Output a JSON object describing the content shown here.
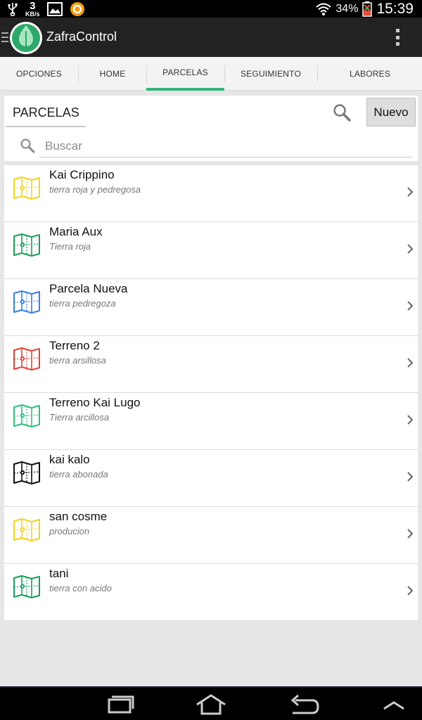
{
  "status_bar": {
    "net_speed_value": "3",
    "net_speed_unit": "KB/s",
    "battery": "34%",
    "time": "15:39",
    "icons": [
      "usb-icon",
      "image-icon",
      "app-notify-icon",
      "wifi-icon",
      "battery-icon"
    ]
  },
  "action_bar": {
    "title": "ZafraControl",
    "icons": [
      "drawer-menu-icon",
      "leaf-logo-icon",
      "overflow-menu-icon"
    ]
  },
  "tabs": [
    {
      "label": "OPCIONES",
      "active": false
    },
    {
      "label": "HOME",
      "active": false
    },
    {
      "label": "PARCELAS",
      "active": true
    },
    {
      "label": "SEGUIMIENTO",
      "active": false
    },
    {
      "label": "LABORES",
      "active": false
    }
  ],
  "search_card": {
    "title": "PARCELAS",
    "new_button_label": "Nuevo",
    "search_placeholder": "Buscar",
    "search_value": ""
  },
  "parcels": [
    {
      "name": "Kai Crippino",
      "description": "tierra roja y pedregosa",
      "color": "#f4d31f"
    },
    {
      "name": "Maria Aux",
      "description": "Tierra roja",
      "color": "#1a9e5c"
    },
    {
      "name": "Parcela Nueva",
      "description": "tierra pedregoza",
      "color": "#3a7ee6"
    },
    {
      "name": "Terreno 2",
      "description": "tierra arsillosa",
      "color": "#e0443a"
    },
    {
      "name": "Terreno Kai Lugo",
      "description": "Tierra arcillosa",
      "color": "#2fc07a"
    },
    {
      "name": "kai kalo",
      "description": "tierra abonada",
      "color": "#111111"
    },
    {
      "name": "san cosme",
      "description": "producion",
      "color": "#f4d31f"
    },
    {
      "name": "tani",
      "description": "tierra con acido",
      "color": "#1a9e5c"
    }
  ],
  "nav_bar": {
    "icons": [
      "recent-apps-icon",
      "home-icon",
      "back-icon",
      "chevron-up-icon"
    ]
  },
  "colors": {
    "accent": "#33b378",
    "action_bar": "#222222",
    "background": "#e6e6e6"
  }
}
